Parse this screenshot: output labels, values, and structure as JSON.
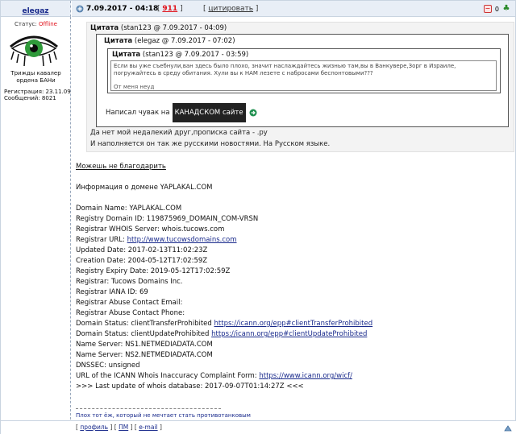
{
  "author": {
    "name": "elegaz",
    "status_label": "Статус:",
    "status_value": "Offline",
    "rank": "Трижды кавалер ордена БАНи",
    "registration": "Регистрация: 23.11.09",
    "messages": "Сообщений: 8021"
  },
  "post_header": {
    "date": "7.09.2017 - 04:18",
    "number_open": "[",
    "number": "911",
    "number_close": "]",
    "quote_open": "[",
    "quote_label": "цитировать",
    "quote_close": "]",
    "rep_count": "0"
  },
  "quote_outer": {
    "title": "Цитата",
    "meta": "(stan123 @ 7.09.2017 - 04:09)",
    "line1": "Да нет мой недалекий друг,прописка сайта - .ру",
    "line2": "И наполняется он так же русскими новостями. На Русском языке."
  },
  "quote_mid": {
    "title": "Цитата",
    "meta": "(elegaz @ 7.09.2017 - 07:02)",
    "text_prefix": "Написал чувак на",
    "highlight": "КАНАДСКОМ сайте"
  },
  "quote_inner": {
    "title": "Цитата",
    "meta": "(stan123 @ 7.09.2017 - 03:59)",
    "text": "Если вы уже съебнули,ван здесь было плохо, значит наслаждайтесь жизнью там,вы в Ванкувере,Зорг в Израиле, погружайтесь в среду обитания. Хули вы к НАМ лезете с набросами беспонтовыми???",
    "signature": "От меня неуд"
  },
  "body": {
    "line_thanks": "Можешь не благодарить",
    "line_info": "Информация о домене YAPLAKAL.COM",
    "whois": {
      "l1": "Domain Name: YAPLAKAL.COM",
      "l2": "Registry Domain ID: 119875969_DOMAIN_COM-VRSN",
      "l3": "Registrar WHOIS Server: whois.tucows.com",
      "l4_label": "Registrar URL: ",
      "l4_link": "http://www.tucowsdomains.com",
      "l5": "Updated Date: 2017-02-13T11:02:23Z",
      "l6": "Creation Date: 2004-05-12T17:02:59Z",
      "l7": "Registry Expiry Date: 2019-05-12T17:02:59Z",
      "l8": "Registrar: Tucows Domains Inc.",
      "l9": "Registrar IANA ID: 69",
      "l10": "Registrar Abuse Contact Email:",
      "l11": "Registrar Abuse Contact Phone:",
      "l12_label": "Domain Status: clientTransferProhibited ",
      "l12_link": "https://icann.org/epp#clientTransferProhibited",
      "l13_label": "Domain Status: clientUpdateProhibited ",
      "l13_link": "https://icann.org/epp#clientUpdateProhibited",
      "l14": "Name Server: NS1.NETMEDIADATA.COM",
      "l15": "Name Server: NS2.NETMEDIADATA.COM",
      "l16": "DNSSEC: unsigned",
      "l17_label": "URL of the ICANN Whois Inaccuracy Complaint Form: ",
      "l17_link": "https://www.icann.org/wicf/",
      "l18": ">>> Last update of whois database: 2017-09-07T01:14:27Z <<<"
    }
  },
  "signature": "Плох тот ёж, который не мечтает стать противотанковым",
  "footer": {
    "profile": "профиль",
    "pm": "ПМ",
    "email": "e-mail"
  },
  "colors": {
    "header_bg": "#e8eef6",
    "offline": "#e0121b",
    "link": "#1a2b8c"
  }
}
